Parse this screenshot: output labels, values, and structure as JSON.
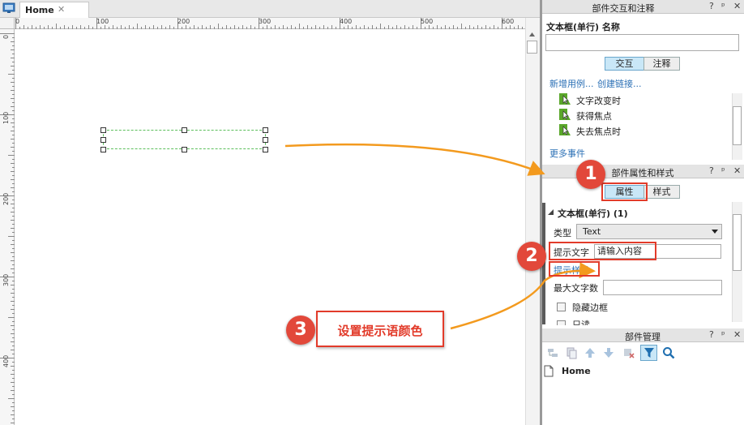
{
  "editor": {
    "tab_label": "Home",
    "tab_close": "✕",
    "ruler_top_labels": [
      "0",
      "100",
      "200",
      "300",
      "400",
      "500",
      "600"
    ],
    "ruler_left_labels": [
      "0",
      "100",
      "200",
      "300",
      "400"
    ]
  },
  "interaction_panel": {
    "title": "部件交互和注释",
    "help": "?",
    "pin": "ᵖ",
    "close": "✕",
    "widget_label": "文本框(单行) 名称",
    "name_value": "",
    "tabs": [
      "交互",
      "注释"
    ],
    "add_case": "新增用例...",
    "create_link": "创建链接...",
    "events": [
      "文字改变时",
      "获得焦点",
      "失去焦点时"
    ],
    "more_events": "更多事件"
  },
  "props_panel": {
    "title": "部件属性和样式",
    "help": "?",
    "pin": "ᵖ",
    "close": "✕",
    "tabs": [
      "属性",
      "样式"
    ],
    "section": "文本框(单行) (1)",
    "type_label": "类型",
    "type_value": "Text",
    "hint_label": "提示文字",
    "hint_value": "请输入内容",
    "hint_style": "提示样式",
    "maxlen_label": "最大文字数",
    "maxlen_value": "",
    "hide_border": "隐藏边框",
    "readonly": "只读"
  },
  "widget_panel": {
    "title": "部件管理",
    "help": "?",
    "pin": "ᵖ",
    "close": "✕",
    "page": "Home"
  },
  "annotations": {
    "step1": "1",
    "step2": "2",
    "step3": "3",
    "callout": "设置提示语颜色"
  },
  "colors": {
    "accent": "#f39a1e",
    "badge": "#e2483a",
    "highlight": "#e23b2a",
    "selection": "#5cbf5c",
    "link": "#2a6fb5"
  }
}
